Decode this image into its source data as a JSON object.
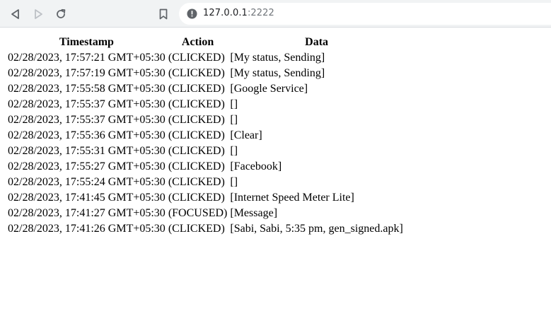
{
  "browser": {
    "url_host": "127.0.0.1",
    "url_port": ":2222",
    "icons": {
      "back": "back-arrow-icon",
      "forward": "forward-arrow-icon",
      "reload": "reload-icon",
      "bookmark": "bookmark-icon",
      "info": "info-icon"
    }
  },
  "table": {
    "headers": [
      "Timestamp",
      "Action",
      "Data"
    ],
    "rows": [
      [
        "02/28/2023, 17:57:21 GMT+05:30",
        "(CLICKED)",
        "[My status, Sending]"
      ],
      [
        "02/28/2023, 17:57:19 GMT+05:30",
        "(CLICKED)",
        "[My status, Sending]"
      ],
      [
        "02/28/2023, 17:55:58 GMT+05:30",
        "(CLICKED)",
        "[Google Service]"
      ],
      [
        "02/28/2023, 17:55:37 GMT+05:30",
        "(CLICKED)",
        "[]"
      ],
      [
        "02/28/2023, 17:55:37 GMT+05:30",
        "(CLICKED)",
        "[]"
      ],
      [
        "02/28/2023, 17:55:36 GMT+05:30",
        "(CLICKED)",
        "[Clear]"
      ],
      [
        "02/28/2023, 17:55:31 GMT+05:30",
        "(CLICKED)",
        "[]"
      ],
      [
        "02/28/2023, 17:55:27 GMT+05:30",
        "(CLICKED)",
        "[Facebook]"
      ],
      [
        "02/28/2023, 17:55:24 GMT+05:30",
        "(CLICKED)",
        "[]"
      ],
      [
        "02/28/2023, 17:41:45 GMT+05:30",
        "(CLICKED)",
        "[Internet Speed Meter Lite]"
      ],
      [
        "02/28/2023, 17:41:27 GMT+05:30",
        "(FOCUSED)",
        "[Message]"
      ],
      [
        "02/28/2023, 17:41:26 GMT+05:30",
        "(CLICKED)",
        "[Sabi, Sabi, 5:35 pm, gen_signed.apk]"
      ]
    ]
  }
}
